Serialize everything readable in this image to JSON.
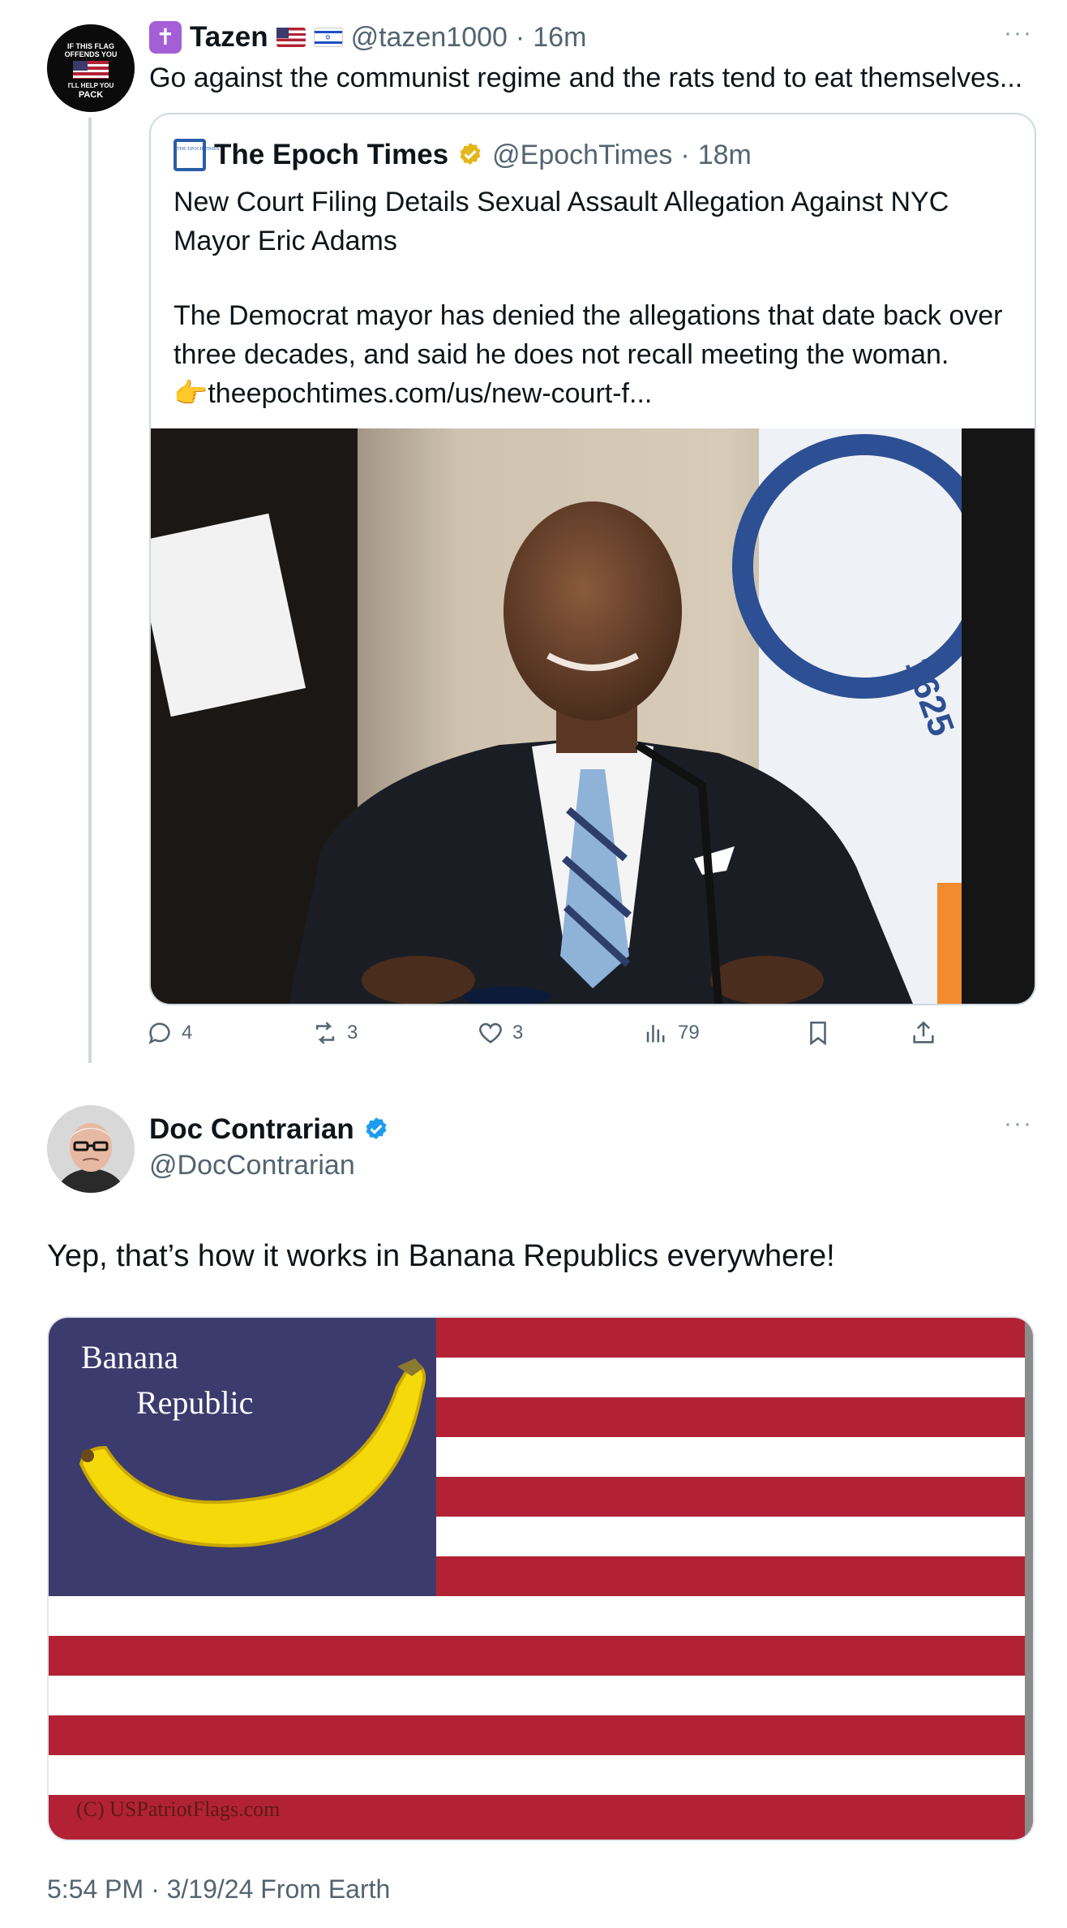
{
  "tweet1": {
    "avatar_text": [
      "IF THIS FLAG",
      "OFFENDS YOU",
      "I'LL HELP YOU",
      "PACK"
    ],
    "name": "Tazen",
    "name_emojis": "✝️",
    "flags": [
      "us-flag",
      "israel-flag"
    ],
    "handle": "@tazen1000",
    "time": "16m",
    "text": "Go against the communist regime and the rats tend to eat themselves...",
    "more_label": "···"
  },
  "quote": {
    "logo_text": "THE EPOCH TIMES",
    "name": "The Epoch Times",
    "verified": "gold",
    "handle": "@EpochTimes",
    "time": "18m",
    "line1": "New Court Filing Details Sexual Assault Allegation Against NYC",
    "line2": "Mayor Eric Adams",
    "line3": "The Democrat mayor has denied the allegations that date back over",
    "line4": "three decades, and said he does not recall meeting the woman.",
    "link_emoji": "👉",
    "link": "theepochtimes.com/us/new-court-f...",
    "seal_text": "1625"
  },
  "actions": {
    "replies": "4",
    "reposts": "3",
    "likes": "3",
    "views": "79"
  },
  "tweet2": {
    "name": "Doc Contrarian",
    "verified": "blue",
    "handle": "@DocContrarian",
    "text": "Yep, that’s how it works in Banana Republics everywhere!",
    "more_label": "···",
    "image": {
      "title1": "Banana",
      "title2": "Republic",
      "credit": "(C) USPatriotFlags.com"
    },
    "timestamp": "5:54 PM · 3/19/24 From Earth"
  },
  "colors": {
    "text": "#0f1419",
    "muted": "#536471",
    "border": "#cfd9de",
    "verified_blue": "#1d9bf0",
    "verified_gold": "#e2b719",
    "flag_red": "#b22234",
    "flag_blue": "#3c3b6e",
    "banana": "#f5d90a"
  }
}
